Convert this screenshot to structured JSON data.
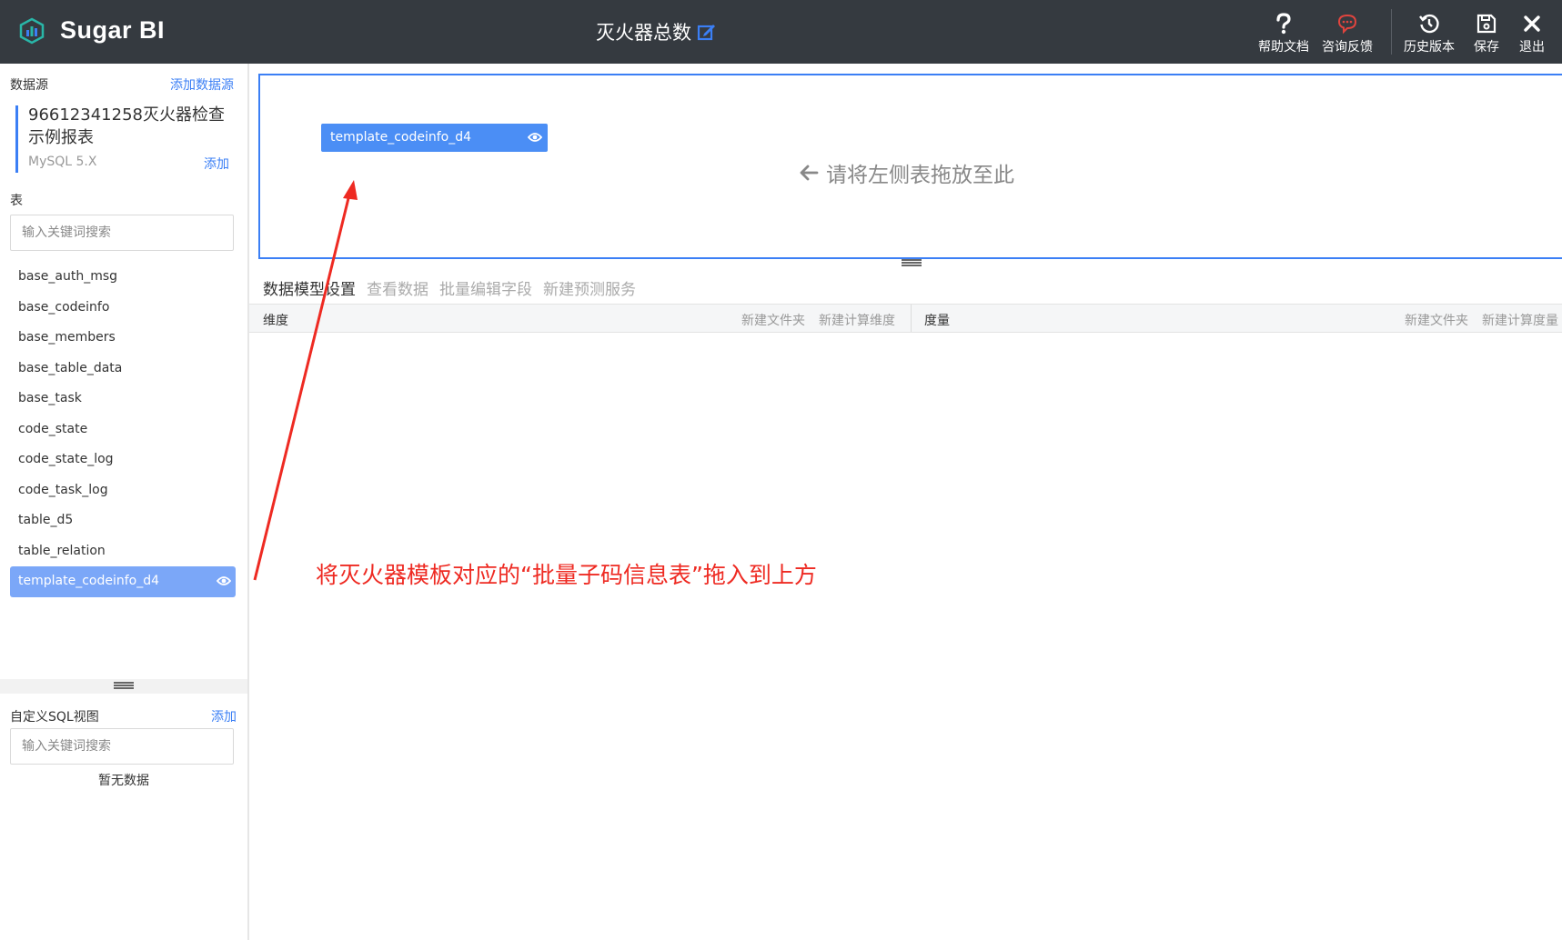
{
  "header": {
    "app_name": "Sugar BI",
    "title": "灭火器总数",
    "tools": {
      "help": "帮助文档",
      "feedback": "咨询反馈",
      "history": "历史版本",
      "save": "保存",
      "exit": "退出"
    }
  },
  "sidebar": {
    "datasource_label": "数据源",
    "add_datasource": "添加数据源",
    "datasource_name": "96612341258灭火器检查示例报表",
    "datasource_type": "MySQL 5.X",
    "datasource_add": "添加",
    "tables_label": "表",
    "search_placeholder": "输入关键词搜索",
    "tables": [
      "base_auth_msg",
      "base_codeinfo",
      "base_members",
      "base_table_data",
      "base_task",
      "code_state",
      "code_state_log",
      "code_task_log",
      "table_d5",
      "table_relation",
      "template_codeinfo_d4"
    ],
    "custom_sql_label": "自定义SQL视图",
    "custom_sql_add": "添加",
    "custom_sql_placeholder": "输入关键词搜索",
    "no_data": "暂无数据"
  },
  "canvas": {
    "chip_label": "template_codeinfo_d4",
    "drop_hint": "请将左侧表拖放至此"
  },
  "tabs": [
    "数据模型设置",
    "查看数据",
    "批量编辑字段",
    "新建预测服务"
  ],
  "fields": {
    "dimension_title": "维度",
    "dimension_actions": [
      "新建文件夹",
      "新建计算维度"
    ],
    "measure_title": "度量",
    "measure_actions": [
      "新建文件夹",
      "新建计算度量"
    ]
  },
  "annotation": "将灭火器模板对应的“批量子码信息表”拖入到上方",
  "colors": {
    "header_bg": "#353a40",
    "accent": "#3b7ff5",
    "active_item": "#7ba7f8",
    "annotation": "#ee2a22",
    "feedback_icon": "#e0443e"
  }
}
